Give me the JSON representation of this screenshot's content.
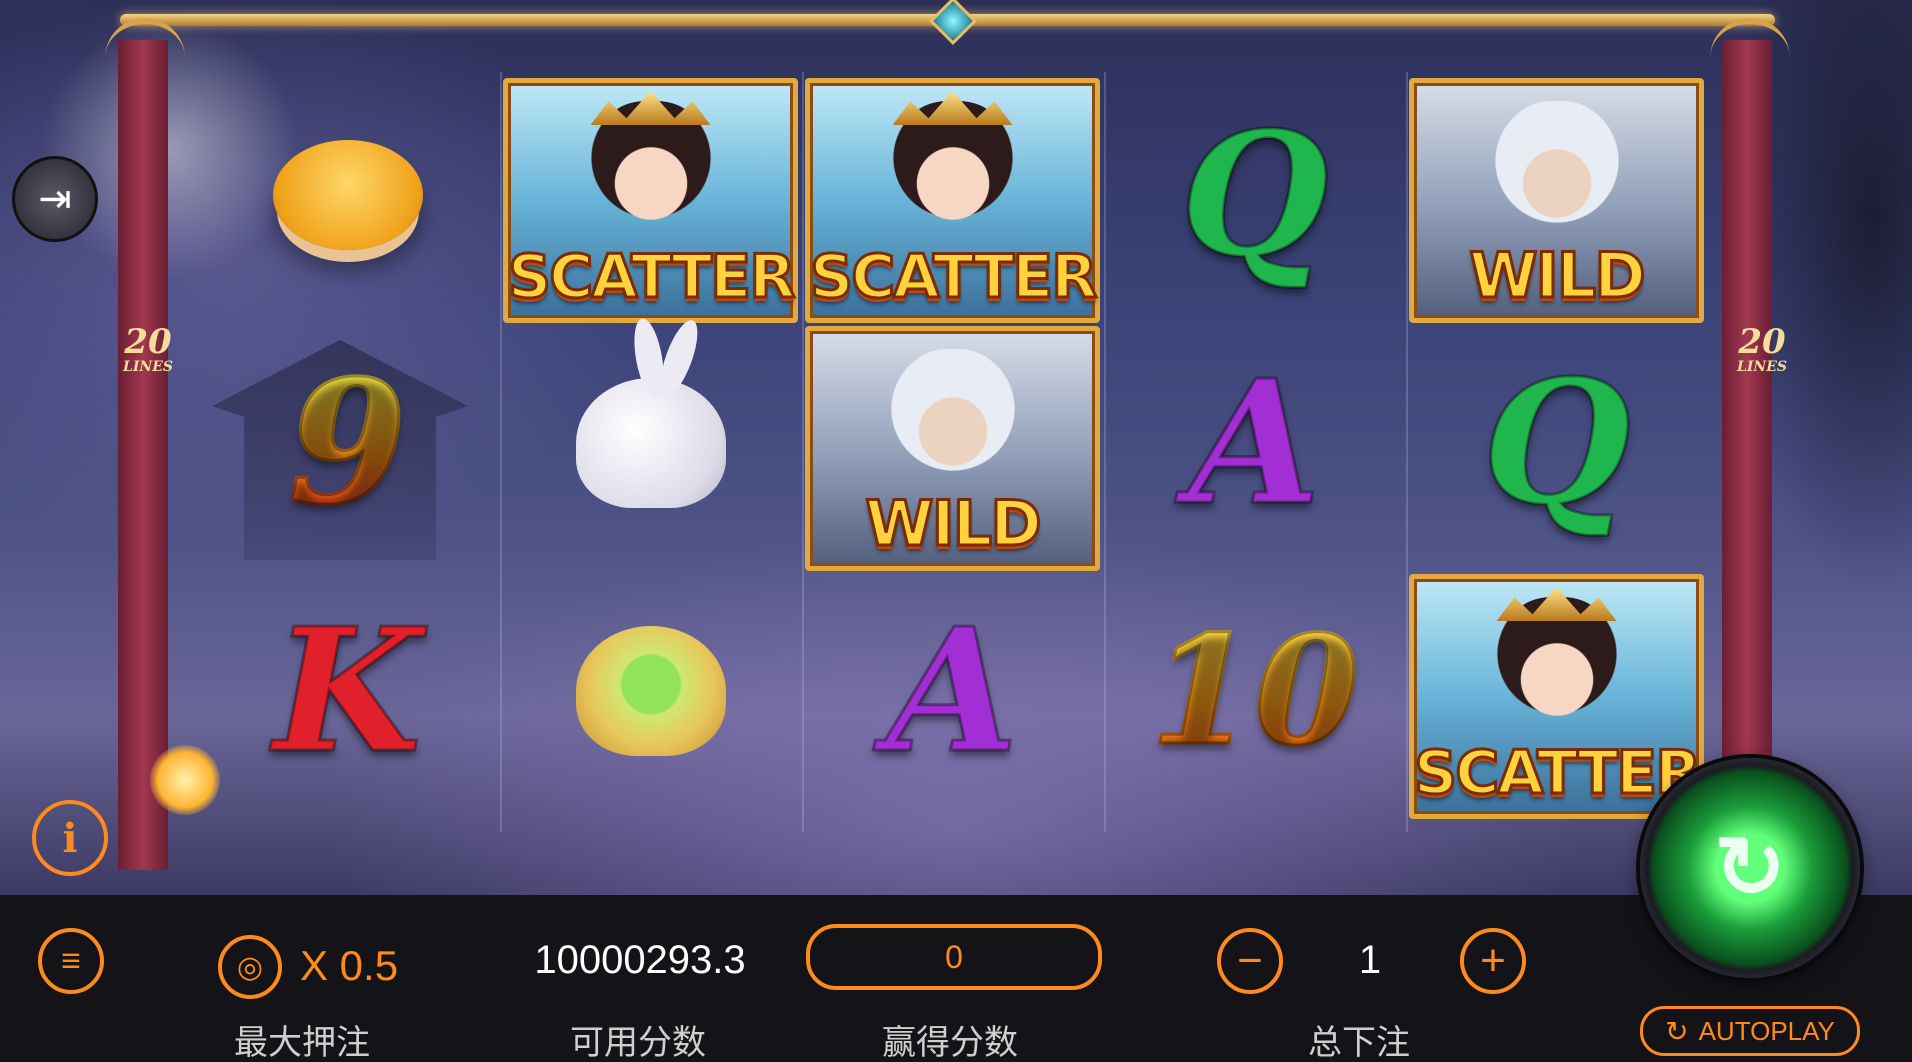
{
  "reels": {
    "lines_left": "20",
    "lines_right": "20",
    "lines_suffix": "LINES",
    "grid": [
      [
        "mooncake",
        "9",
        "K"
      ],
      [
        "scatter",
        "rabbit",
        "lotus"
      ],
      [
        "scatter",
        "wild",
        "A"
      ],
      [
        "Q",
        "A",
        "10"
      ],
      [
        "wild",
        "Q",
        "scatter"
      ]
    ],
    "labels": {
      "scatter": "SCATTER",
      "wild": "WILD",
      "q": "Q",
      "a": "A",
      "k": "K",
      "nine": "9",
      "ten": "10"
    }
  },
  "controls": {
    "multiplier": "X 0.5",
    "balance": "10000293.3",
    "win": "0",
    "bet": "1",
    "autoplay": "AUTOPLAY",
    "captions": {
      "max_bet": "最大押注",
      "balance": "可用分数",
      "win": "赢得分数",
      "total_bet": "总下注"
    }
  },
  "icons": {
    "exit": "exit-icon",
    "info": "info-icon",
    "menu": "menu-icon",
    "coins": "coins-icon",
    "minus": "minus-icon",
    "plus": "plus-icon",
    "spin": "spin-icon",
    "autoplay": "refresh-icon"
  },
  "colors": {
    "accent": "#ff8a1c",
    "scatter_text": "#ffd23e",
    "spin_green": "#1a9c3a"
  }
}
